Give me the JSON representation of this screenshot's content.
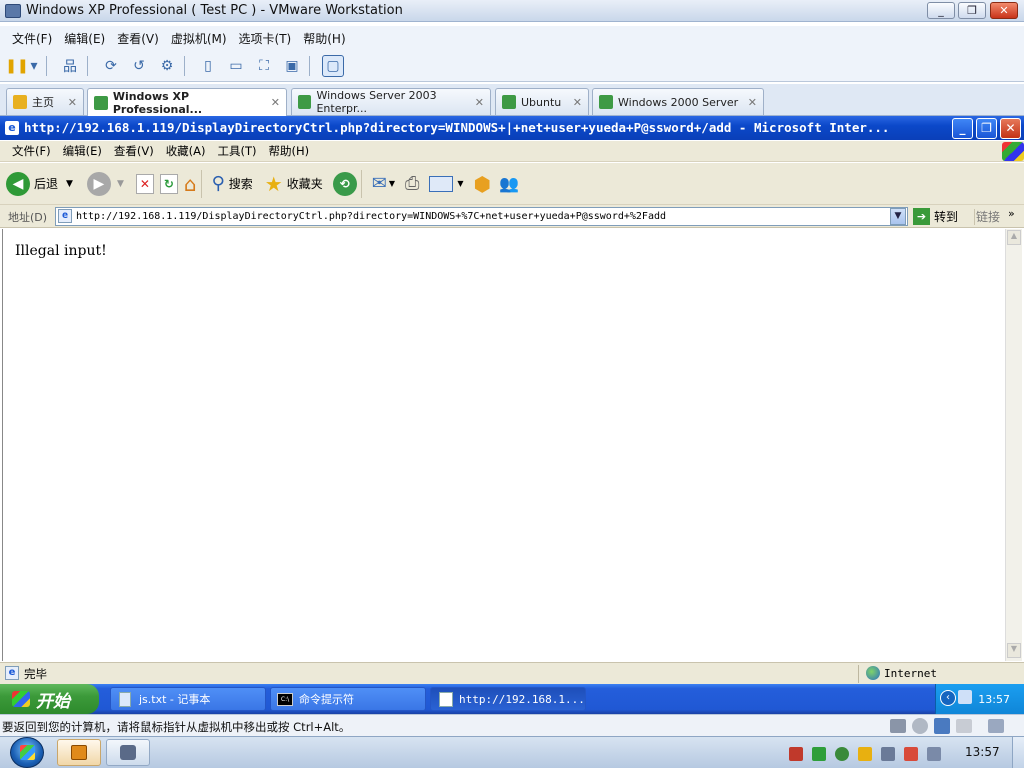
{
  "vmware": {
    "title": "Windows XP Professional ( Test PC ) - VMware Workstation",
    "menu": [
      "文件(F)",
      "编辑(E)",
      "查看(V)",
      "虚拟机(M)",
      "选项卡(T)",
      "帮助(H)"
    ],
    "tabs": [
      {
        "label": "主页"
      },
      {
        "label": "Windows XP Professional..."
      },
      {
        "label": "Windows Server 2003 Enterpr..."
      },
      {
        "label": "Ubuntu"
      },
      {
        "label": "Windows 2000 Server"
      }
    ],
    "status_text": "要返回到您的计算机，请将鼠标指针从虚拟机中移出或按 Ctrl+Alt。"
  },
  "ie": {
    "title": "http://192.168.1.119/DisplayDirectoryCtrl.php?directory=WINDOWS+|+net+user+yueda+P@ssword+/add - Microsoft Inter...",
    "menu": [
      "文件(F)",
      "编辑(E)",
      "查看(V)",
      "收藏(A)",
      "工具(T)",
      "帮助(H)"
    ],
    "toolbar": {
      "back": "后退",
      "search": "搜索",
      "favorites": "收藏夹"
    },
    "address_label": "地址(D)",
    "address": "http://192.168.1.119/DisplayDirectoryCtrl.php?directory=WINDOWS+%7C+net+user+yueda+P@ssword+%2Fadd",
    "go": "转到",
    "links": "链接",
    "page_message": "Illegal input!",
    "status": "完毕",
    "zone": "Internet"
  },
  "xp_taskbar": {
    "start": "开始",
    "buttons": [
      "js.txt - 记事本",
      "命令提示符",
      "http://192.168.1..."
    ],
    "clock": "13:57"
  },
  "win7_taskbar": {
    "clock": "13:57"
  }
}
